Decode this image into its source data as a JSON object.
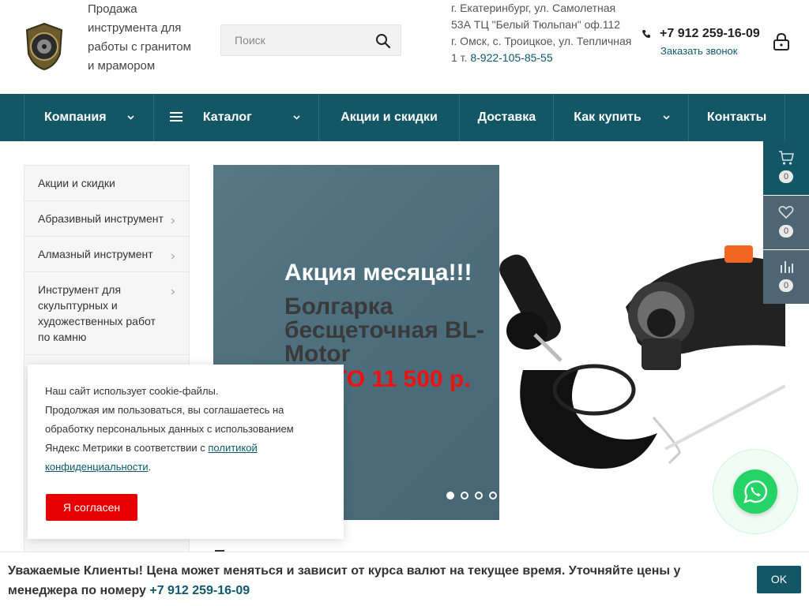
{
  "header": {
    "tagline": "Продажа инструмента для работы с гранитом и мрамором",
    "search_placeholder": "Поиск",
    "address_line1": "г. Екатеринбург, ул. Самолетная 53А ТЦ \"Белый Тюльпан\" оф.112",
    "address_line2": "г. Омск, с. Троицкое, ул. Тепличная 1 т.",
    "address_phone": "8-922-105-85-55",
    "phone": "+7 912 259-16-09",
    "callback": "Заказать звонок"
  },
  "nav": {
    "company": "Компания",
    "catalog": "Каталог",
    "promo": "Акции и скидки",
    "delivery": "Доставка",
    "how_to_buy": "Как купить",
    "contacts": "Контакты"
  },
  "sidebar": {
    "items": [
      {
        "label": "Акции и скидки"
      },
      {
        "label": "Абразивный инструмент"
      },
      {
        "label": "Алмазный инструмент"
      },
      {
        "label": "Инструмент для скульптурных и художественных работ по камню"
      }
    ]
  },
  "banner": {
    "title": "Акция месяца!!!",
    "product": "Болгарка бесщеточная BL-Motor",
    "price": "ВСЕГО 11 500 р.",
    "slides": 4,
    "active_slide": 1
  },
  "toolbar": {
    "cart_count": "0",
    "favorites_count": "0",
    "compare_count": "0"
  },
  "cookie": {
    "text1": "Наш сайт использует cookie-файлы.",
    "text2": "Продолжая им пользоваться, вы соглашаетесь на обработку персональных данных с использованием Яндекс Метрики в соответствии с",
    "link": "политикой конфиденциальности",
    "dot": ".",
    "agree": "Я согласен"
  },
  "notice": {
    "text": "Уважаемые Клиенты! Цена может меняться и зависит от курса валют на текущее время. Уточняйте цены у менеджера по номеру",
    "phone": "+7 912 259-16-09",
    "ok": "OK"
  },
  "colors": {
    "brand": "#135767",
    "accent_red": "#e60000",
    "whatsapp": "#25d366"
  }
}
